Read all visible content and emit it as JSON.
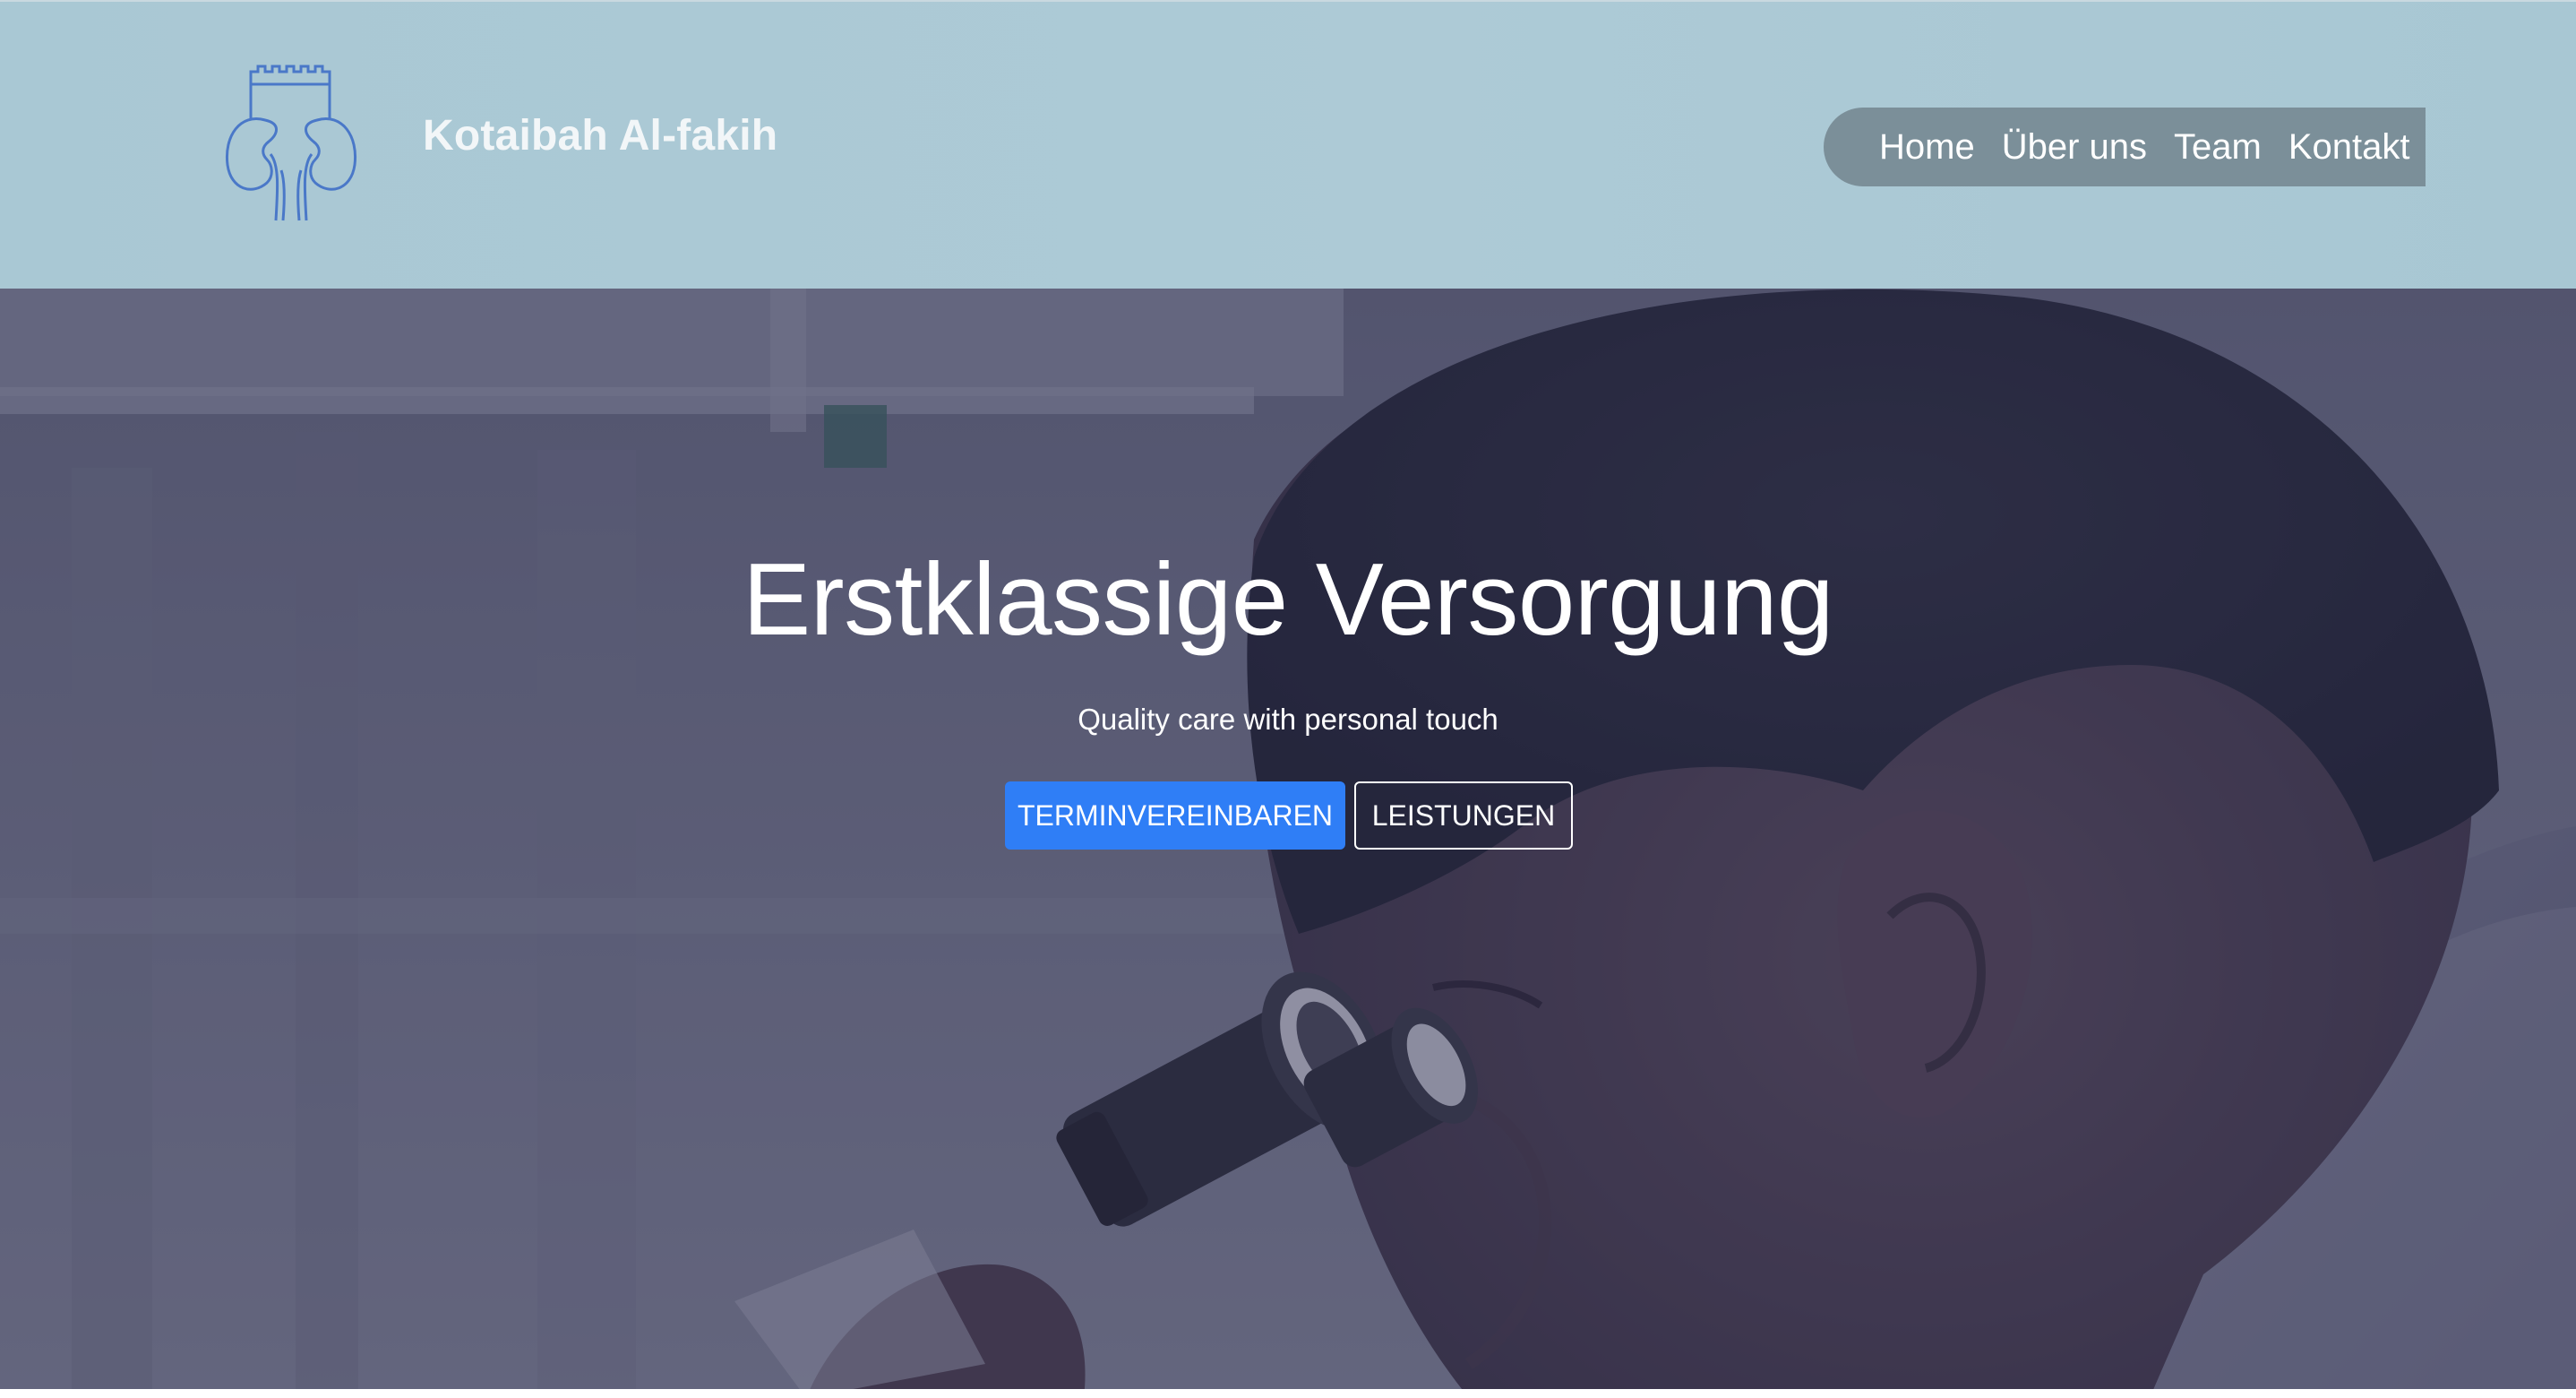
{
  "header": {
    "brand_name": "Kotaibah Al-fakih",
    "logo_icon": "kidney-castle-logo-icon",
    "nav": [
      {
        "label": "Home"
      },
      {
        "label": "Über uns"
      },
      {
        "label": "Team"
      },
      {
        "label": "Kontakt"
      }
    ]
  },
  "hero": {
    "title": "Erstklassige Versorgung",
    "subtitle": "Quality care with personal touch",
    "primary_button": "TERMINVEREINBAREN",
    "secondary_button": "LEISTUNGEN",
    "background_image": "scientist-looking-into-microscope-photo"
  },
  "colors": {
    "header_bg": "#adcad6",
    "nav_bg": "#7b8f99",
    "primary_button": "#2f7ef6",
    "logo_stroke": "#4a78c8",
    "hero_overlay": "#2d2d4e"
  }
}
